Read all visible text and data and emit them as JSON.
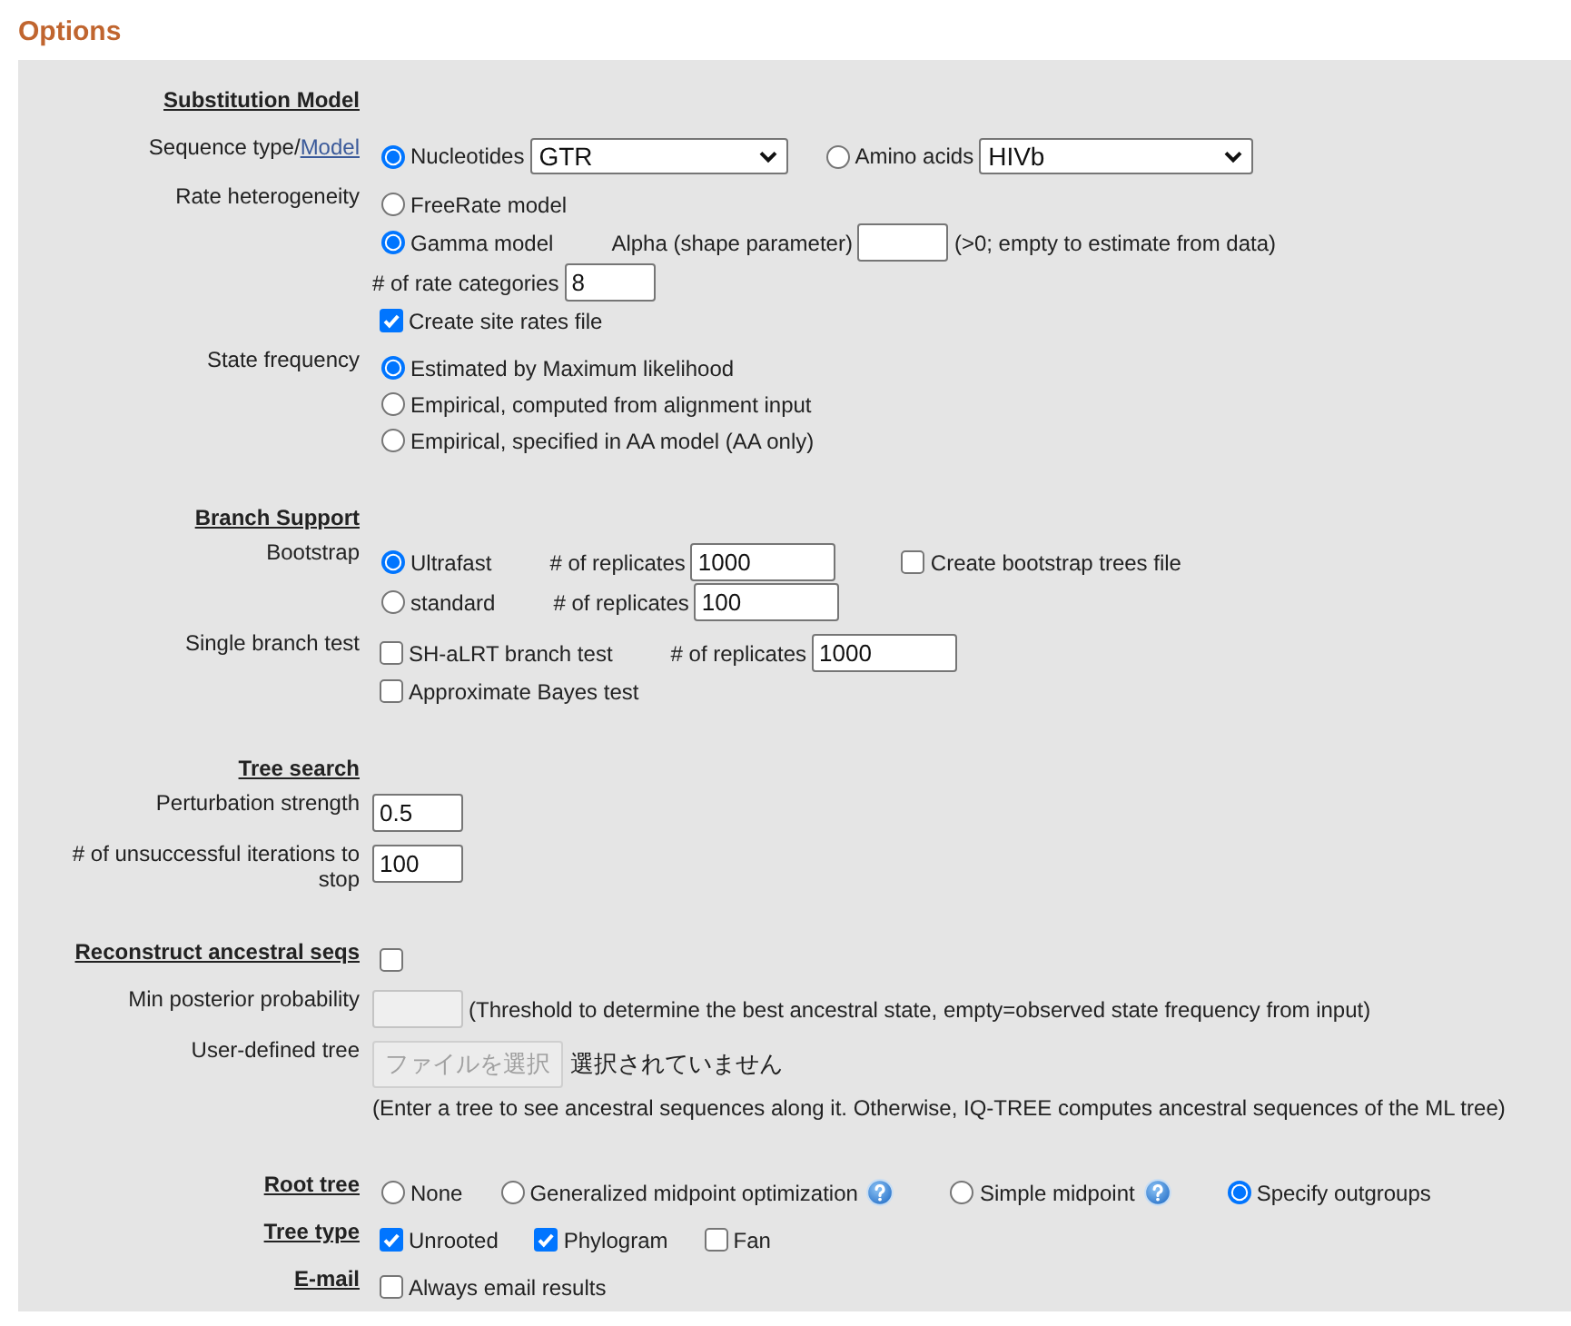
{
  "title": "Options",
  "sections": [
    {
      "rows": [
        {
          "kind": "heading",
          "label": "Substitution Model"
        },
        {
          "kind": "field",
          "label": "Sequence type/",
          "link": "Model",
          "lines": [
            {
              "items": [
                {
                  "kind": "radio",
                  "label": "Nucleotides",
                  "selected": true
                },
                {
                  "kind": "select",
                  "value": "GTR"
                },
                {
                  "kind": "radio",
                  "label": "Amino acids",
                  "selected": false
                },
                {
                  "kind": "select",
                  "value": "HIVb"
                }
              ]
            }
          ]
        },
        {
          "kind": "field",
          "label": "Rate heterogeneity",
          "lines": [
            {
              "items": [
                {
                  "kind": "radio",
                  "label": "FreeRate model",
                  "selected": false
                }
              ]
            },
            {
              "items": [
                {
                  "kind": "radio",
                  "label": "Gamma model",
                  "selected": true
                },
                {
                  "kind": "text",
                  "text": "Alpha (shape parameter)"
                },
                {
                  "kind": "input",
                  "disabled": false
                },
                {
                  "kind": "text",
                  "text": "(>0; empty to estimate from data)"
                }
              ]
            },
            {
              "items": [
                {
                  "kind": "text",
                  "text": "# of rate categories"
                },
                {
                  "kind": "input",
                  "value": "8",
                  "disabled": false
                }
              ]
            },
            {
              "items": [
                {
                  "kind": "checkbox",
                  "label": "Create site rates file",
                  "checked": true
                }
              ]
            }
          ]
        },
        {
          "kind": "field",
          "label": "State frequency",
          "lines": [
            {
              "items": [
                {
                  "kind": "radio",
                  "label": "Estimated by Maximum likelihood",
                  "selected": true
                }
              ]
            },
            {
              "items": [
                {
                  "kind": "radio",
                  "label": "Empirical, computed from alignment input",
                  "selected": false
                }
              ]
            },
            {
              "items": [
                {
                  "kind": "radio",
                  "label": "Empirical, specified in AA model (AA only)",
                  "selected": false
                }
              ]
            }
          ]
        }
      ]
    },
    {
      "rows": [
        {
          "kind": "heading",
          "label": "Branch Support"
        },
        {
          "kind": "field",
          "label": "Bootstrap",
          "lines": [
            {
              "items": [
                {
                  "kind": "radio",
                  "label": "Ultrafast",
                  "selected": true
                },
                {
                  "kind": "text",
                  "text": "# of replicates"
                },
                {
                  "kind": "input",
                  "value": "1000",
                  "disabled": false
                },
                {
                  "kind": "checkbox",
                  "label": "Create bootstrap trees file",
                  "checked": false
                }
              ]
            },
            {
              "items": [
                {
                  "kind": "radio",
                  "label": "standard",
                  "selected": false
                },
                {
                  "kind": "text",
                  "text": "# of replicates"
                },
                {
                  "kind": "input",
                  "value": "100",
                  "disabled": false
                }
              ]
            }
          ]
        },
        {
          "kind": "field",
          "label": "Single branch test",
          "lines": [
            {
              "items": [
                {
                  "kind": "checkbox",
                  "label": "SH-aLRT branch test",
                  "checked": false
                },
                {
                  "kind": "text",
                  "text": "# of replicates"
                },
                {
                  "kind": "input",
                  "value": "1000",
                  "disabled": false
                }
              ]
            },
            {
              "items": [
                {
                  "kind": "checkbox",
                  "label": "Approximate Bayes test",
                  "checked": false
                }
              ]
            }
          ]
        }
      ]
    },
    {
      "rows": [
        {
          "kind": "heading",
          "label": "Tree search"
        },
        {
          "kind": "field",
          "label": "Perturbation strength",
          "lines": [
            {
              "items": [
                {
                  "kind": "input",
                  "value": "0.5",
                  "disabled": false
                }
              ]
            }
          ]
        },
        {
          "kind": "field",
          "label": "# of unsuccessful iterations to stop",
          "lines": [
            {
              "items": [
                {
                  "kind": "input",
                  "value": "100",
                  "disabled": false
                }
              ]
            }
          ]
        }
      ]
    },
    {
      "rows": [
        {
          "kind": "heading",
          "label": "Reconstruct ancestral seqs",
          "lines": [
            {
              "items": [
                {
                  "kind": "checkbox",
                  "checked": false
                }
              ]
            }
          ]
        },
        {
          "kind": "field",
          "label": "Min posterior probability",
          "lines": [
            {
              "items": [
                {
                  "kind": "input",
                  "disabled": true
                },
                {
                  "kind": "text",
                  "text": "(Threshold to determine the best ancestral state, empty=observed state frequency from input)"
                }
              ]
            }
          ]
        },
        {
          "kind": "field",
          "label": "User-defined tree",
          "lines": [
            {
              "items": [
                {
                  "kind": "file",
                  "button": "ファイルを選択",
                  "status": "選択されていません",
                  "disabled": true
                }
              ]
            },
            {
              "items": [
                {
                  "kind": "text",
                  "text": "(Enter a tree to see ancestral sequences along it. Otherwise, IQ-TREE computes ancestral sequences of the ML tree)"
                }
              ]
            }
          ]
        }
      ]
    },
    {
      "rows": [
        {
          "kind": "heading",
          "label": "Root tree",
          "lines": [
            {
              "items": [
                {
                  "kind": "radio",
                  "label": "None",
                  "selected": false
                },
                {
                  "kind": "radio",
                  "label": "Generalized midpoint optimization",
                  "selected": false
                },
                {
                  "kind": "help"
                },
                {
                  "kind": "radio",
                  "label": "Simple midpoint",
                  "selected": false
                },
                {
                  "kind": "help"
                },
                {
                  "kind": "radio",
                  "label": "Specify outgroups",
                  "selected": true
                }
              ]
            }
          ]
        },
        {
          "kind": "heading",
          "label": "Tree type",
          "lines": [
            {
              "items": [
                {
                  "kind": "checkbox",
                  "label": "Unrooted",
                  "checked": true
                },
                {
                  "kind": "checkbox",
                  "label": "Phylogram",
                  "checked": true
                },
                {
                  "kind": "checkbox",
                  "label": "Fan",
                  "checked": false
                }
              ]
            }
          ]
        },
        {
          "kind": "heading",
          "label": "E-mail",
          "lines": [
            {
              "items": [
                {
                  "kind": "checkbox",
                  "label": "Always email results",
                  "checked": false
                }
              ]
            }
          ]
        }
      ]
    }
  ]
}
